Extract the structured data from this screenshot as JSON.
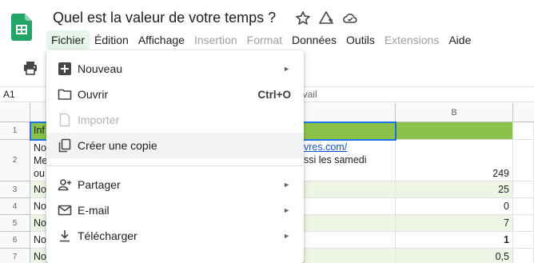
{
  "app": {
    "title": "Quel est la valeur de votre temps ?",
    "logo": "google-sheets-logo",
    "title_icons": [
      "star-icon",
      "move-to-folder-icon",
      "cloud-status-icon"
    ]
  },
  "menubar": {
    "items": [
      {
        "label": "Fichier",
        "state": "active"
      },
      {
        "label": "Édition",
        "state": "normal"
      },
      {
        "label": "Affichage",
        "state": "normal"
      },
      {
        "label": "Insertion",
        "state": "disabled"
      },
      {
        "label": "Format",
        "state": "disabled"
      },
      {
        "label": "Données",
        "state": "normal"
      },
      {
        "label": "Outils",
        "state": "normal"
      },
      {
        "label": "Extensions",
        "state": "disabled"
      },
      {
        "label": "Aide",
        "state": "normal"
      }
    ]
  },
  "toolbar": {
    "print_icon": "print-icon"
  },
  "formula_bar": {
    "cell_ref": "A1",
    "partial_text": "avail"
  },
  "grid": {
    "columns": [
      "B"
    ],
    "rows": [
      {
        "num": "1",
        "a": "Inf",
        "b_text": "",
        "b": ""
      },
      {
        "num": "2",
        "a_lines": [
          "No",
          "Me",
          "ou"
        ],
        "b_text_lines": [
          "vres.com/",
          "ssi les samedi"
        ],
        "b": "249"
      },
      {
        "num": "3",
        "a": "No",
        "b": "25"
      },
      {
        "num": "4",
        "a": "No",
        "b": "0"
      },
      {
        "num": "5",
        "a": "No",
        "b": "7"
      },
      {
        "num": "6",
        "a": "No",
        "b": "1"
      },
      {
        "num": "7",
        "a": "No",
        "b": "0,5"
      }
    ]
  },
  "file_menu": {
    "items": [
      {
        "label": "Nouveau",
        "icon": "new-spreadsheet-icon",
        "submenu": "►",
        "state": "normal"
      },
      {
        "label": "Ouvrir",
        "icon": "folder-icon",
        "shortcut": "Ctrl+O",
        "state": "normal"
      },
      {
        "label": "Importer",
        "icon": "import-file-icon",
        "state": "disabled"
      },
      {
        "label": "Créer une copie",
        "icon": "copy-icon",
        "state": "hover"
      },
      {
        "label": "Partager",
        "icon": "share-person-icon",
        "submenu": "►",
        "state": "normal"
      },
      {
        "label": "E-mail",
        "icon": "email-icon",
        "submenu": "►",
        "state": "normal"
      },
      {
        "label": "Télécharger",
        "icon": "download-icon",
        "submenu": "►",
        "state": "normal"
      }
    ]
  },
  "colors": {
    "accent_green": "#8bc34a",
    "row_tint": "#eef5e5",
    "menu_active_bg": "#e6f4ea",
    "link": "#1155cc"
  }
}
